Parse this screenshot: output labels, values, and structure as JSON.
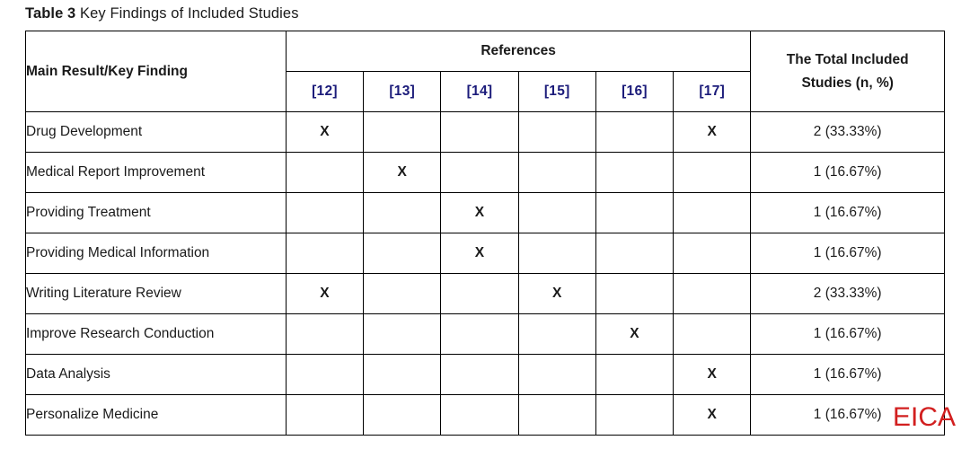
{
  "caption": {
    "label": "Table 3",
    "text": " Key Findings of Included Studies"
  },
  "colors": {
    "reference_label": "#1b1b7a",
    "watermark": "#d21f1f",
    "border": "#000000",
    "text": "#1a1a1a"
  },
  "table": {
    "headers": {
      "finding": "Main Result/Key Finding",
      "references_group": "References",
      "total_line1": "The Total Included",
      "total_line2": "Studies (n, %)",
      "reference_columns": [
        "[12]",
        "[13]",
        "[14]",
        "[15]",
        "[16]",
        "[17]"
      ]
    },
    "mark_symbol": "X",
    "rows": [
      {
        "finding": "Drug Development",
        "marks": [
          "X",
          "",
          "",
          "",
          "",
          "X"
        ],
        "total": "2 (33.33%)"
      },
      {
        "finding": "Medical Report Improvement",
        "marks": [
          "",
          "X",
          "",
          "",
          "",
          ""
        ],
        "total": "1 (16.67%)"
      },
      {
        "finding": "Providing Treatment",
        "marks": [
          "",
          "",
          "X",
          "",
          "",
          ""
        ],
        "total": "1 (16.67%)"
      },
      {
        "finding": "Providing Medical Information",
        "marks": [
          "",
          "",
          "X",
          "",
          "",
          ""
        ],
        "total": "1 (16.67%)"
      },
      {
        "finding": "Writing Literature Review",
        "marks": [
          "X",
          "",
          "",
          "X",
          "",
          ""
        ],
        "total": "2 (33.33%)"
      },
      {
        "finding": "Improve Research Conduction",
        "marks": [
          "",
          "",
          "",
          "",
          "X",
          ""
        ],
        "total": "1 (16.67%)"
      },
      {
        "finding": "Data Analysis",
        "marks": [
          "",
          "",
          "",
          "",
          "",
          "X"
        ],
        "total": "1 (16.67%)"
      },
      {
        "finding": "Personalize Medicine",
        "marks": [
          "",
          "",
          "",
          "",
          "",
          "X"
        ],
        "total": "1 (16.67%)"
      }
    ]
  },
  "watermark": {
    "text": "EICA"
  }
}
